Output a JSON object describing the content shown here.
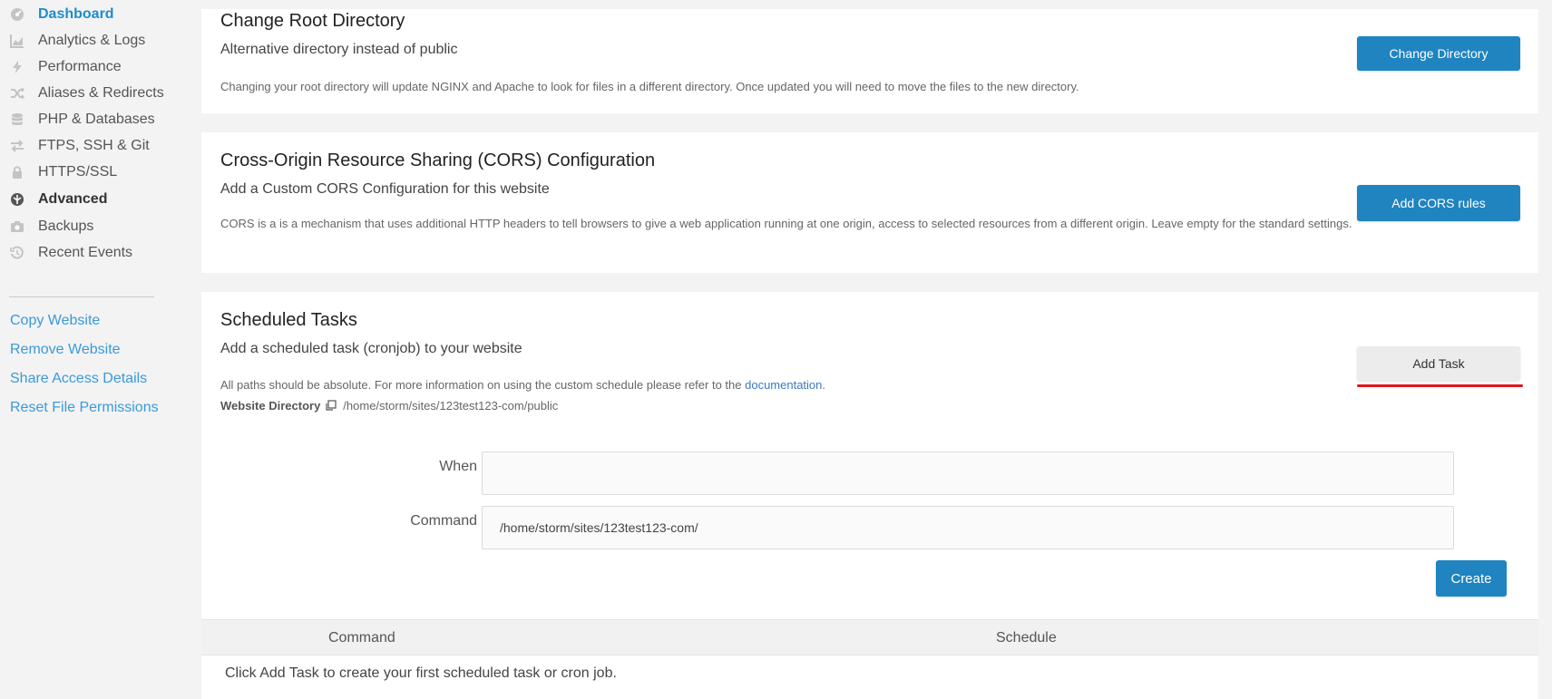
{
  "sidebar": {
    "items": [
      {
        "label": "Dashboard",
        "icon": "dashboard-icon"
      },
      {
        "label": "Analytics & Logs",
        "icon": "chart-icon"
      },
      {
        "label": "Performance",
        "icon": "bolt-icon"
      },
      {
        "label": "Aliases & Redirects",
        "icon": "shuffle-icon"
      },
      {
        "label": "PHP & Databases",
        "icon": "database-icon"
      },
      {
        "label": "FTPS, SSH & Git",
        "icon": "exchange-icon"
      },
      {
        "label": "HTTPS/SSL",
        "icon": "lock-icon"
      },
      {
        "label": "Advanced",
        "icon": "advanced-icon"
      },
      {
        "label": "Backups",
        "icon": "camera-icon"
      },
      {
        "label": "Recent Events",
        "icon": "history-icon"
      }
    ],
    "links": [
      "Copy Website",
      "Remove Website",
      "Share Access Details",
      "Reset File Permissions"
    ]
  },
  "root_dir": {
    "title": "Change Root Directory",
    "subtitle": "Alternative directory instead of public",
    "description": "Changing your root directory will update NGINX and Apache to look for files in a different directory. Once updated you will need to move the files to the new directory.",
    "button": "Change Directory"
  },
  "cors": {
    "title": "Cross-Origin Resource Sharing (CORS) Configuration",
    "subtitle": "Add a Custom CORS Configuration for this website",
    "description": "CORS is a is a mechanism that uses additional HTTP headers to tell browsers to give a web application running at one origin, access to selected resources from a different origin. Leave empty for the standard settings.",
    "button": "Add CORS rules"
  },
  "tasks": {
    "title": "Scheduled Tasks",
    "subtitle": "Add a scheduled task (cronjob) to your website",
    "description_pre": "All paths should be absolute. For more information on using the custom schedule please refer to the ",
    "description_link": "documentation",
    "description_post": ".",
    "dir_label": "Website Directory",
    "dir_path": "/home/storm/sites/123test123-com/public",
    "button": "Add Task",
    "form": {
      "when_label": "When",
      "when_value": "",
      "command_label": "Command",
      "command_value": "/home/storm/sites/123test123-com/",
      "create_button": "Create"
    },
    "table": {
      "headers": [
        "Command",
        "Schedule"
      ],
      "empty": "Click Add Task to create your first scheduled task or cron job."
    }
  },
  "colors": {
    "accent": "#1f84c0",
    "link": "#3a9ad9",
    "highlight": "#e0141e"
  }
}
